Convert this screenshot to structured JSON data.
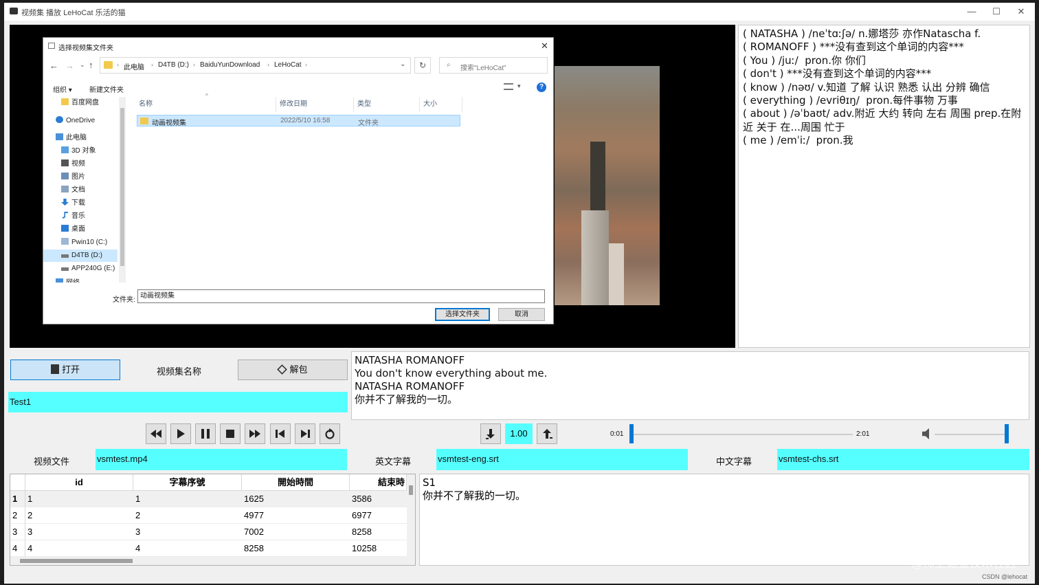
{
  "window": {
    "title": "视频集 播放  LeHoCat 乐活的猫",
    "minimize": "—",
    "maximize": "☐",
    "close": "✕"
  },
  "dialog": {
    "title": "选择视频集文件夹",
    "close": "✕",
    "breadcrumb": [
      "此电脑",
      "D4TB (D:)",
      "BaiduYunDownload",
      "LeHoCat"
    ],
    "search_placeholder": "搜索\"LeHoCat\"",
    "toolbar": {
      "organize": "组织 ▾",
      "new_folder": "新建文件夹"
    },
    "nav_items": [
      "百度网盘",
      "OneDrive",
      "此电脑",
      "3D 对象",
      "视频",
      "图片",
      "文档",
      "下载",
      "音乐",
      "桌面",
      "Pwin10 (C:)",
      "D4TB (D:)",
      "APP240G (E:)",
      "网络"
    ],
    "columns": [
      "名称",
      "修改日期",
      "类型",
      "大小"
    ],
    "files": [
      {
        "name": "动画视频集",
        "date": "2022/5/10 16:58",
        "type": "文件夹",
        "size": ""
      }
    ],
    "folder_label": "文件夹:",
    "folder_value": "动画视频集",
    "select_button": "选择文件夹",
    "cancel_button": "取消"
  },
  "dictionary": [
    "( NATASHA ) /neˈtɑːʃə/ n.娜塔莎 亦作Natascha f.",
    "( ROMANOFF ) ***没有查到这个单词的内容***",
    "( You ) /juː/  pron.你 你们",
    "( don't ) ***没有查到这个单词的内容***",
    "( know ) /nəʊ/ v.知道 了解 认识 熟悉 认出 分辨 确信",
    "( everything ) /evriθɪŋ/  pron.每件事物 万事",
    "( about ) /əˈbaʊt/ adv.附近 大约 转向 左右 周围 prep.在附近 关于 在...周围 忙于",
    "( me ) /emˈiː/  pron.我"
  ],
  "controls": {
    "open_button": "打开",
    "collection_label": "视频集名称",
    "unpack_button": "解包",
    "collection_name": "Test1",
    "speed": "1.00",
    "time_start": "0:01",
    "time_end": "2:01",
    "video_file_label": "视频文件",
    "video_file": "vsmtest.mp4",
    "eng_sub_label": "英文字幕",
    "eng_sub_file": "vsmtest-eng.srt",
    "chs_sub_label": "中文字幕",
    "chs_sub_file": "vsmtest-chs.srt"
  },
  "subtitle_lines": [
    "NATASHA ROMANOFF",
    "You don't know everything about me.",
    "NATASHA ROMANOFF",
    "你并不了解我的一切。"
  ],
  "table": {
    "headers": [
      "id",
      "字幕序號",
      "開始時間",
      "結束時"
    ],
    "rows": [
      {
        "rownum": "1",
        "id": "1",
        "seq": "1",
        "start": "1625",
        "end": "3586"
      },
      {
        "rownum": "2",
        "id": "2",
        "seq": "2",
        "start": "4977",
        "end": "6977"
      },
      {
        "rownum": "3",
        "id": "3",
        "seq": "3",
        "start": "7002",
        "end": "8258"
      },
      {
        "rownum": "4",
        "id": "4",
        "seq": "4",
        "start": "8258",
        "end": "10258"
      }
    ]
  },
  "detail_text": [
    "S1",
    "你并不了解我的一切。"
  ],
  "watermarks": {
    "main": "@稀土掘金技术社区",
    "small": "CSDN @lehocat"
  },
  "colors": {
    "accent": "#0078d4",
    "cyan_field": "#55ffff",
    "video_bg": "#000000"
  }
}
